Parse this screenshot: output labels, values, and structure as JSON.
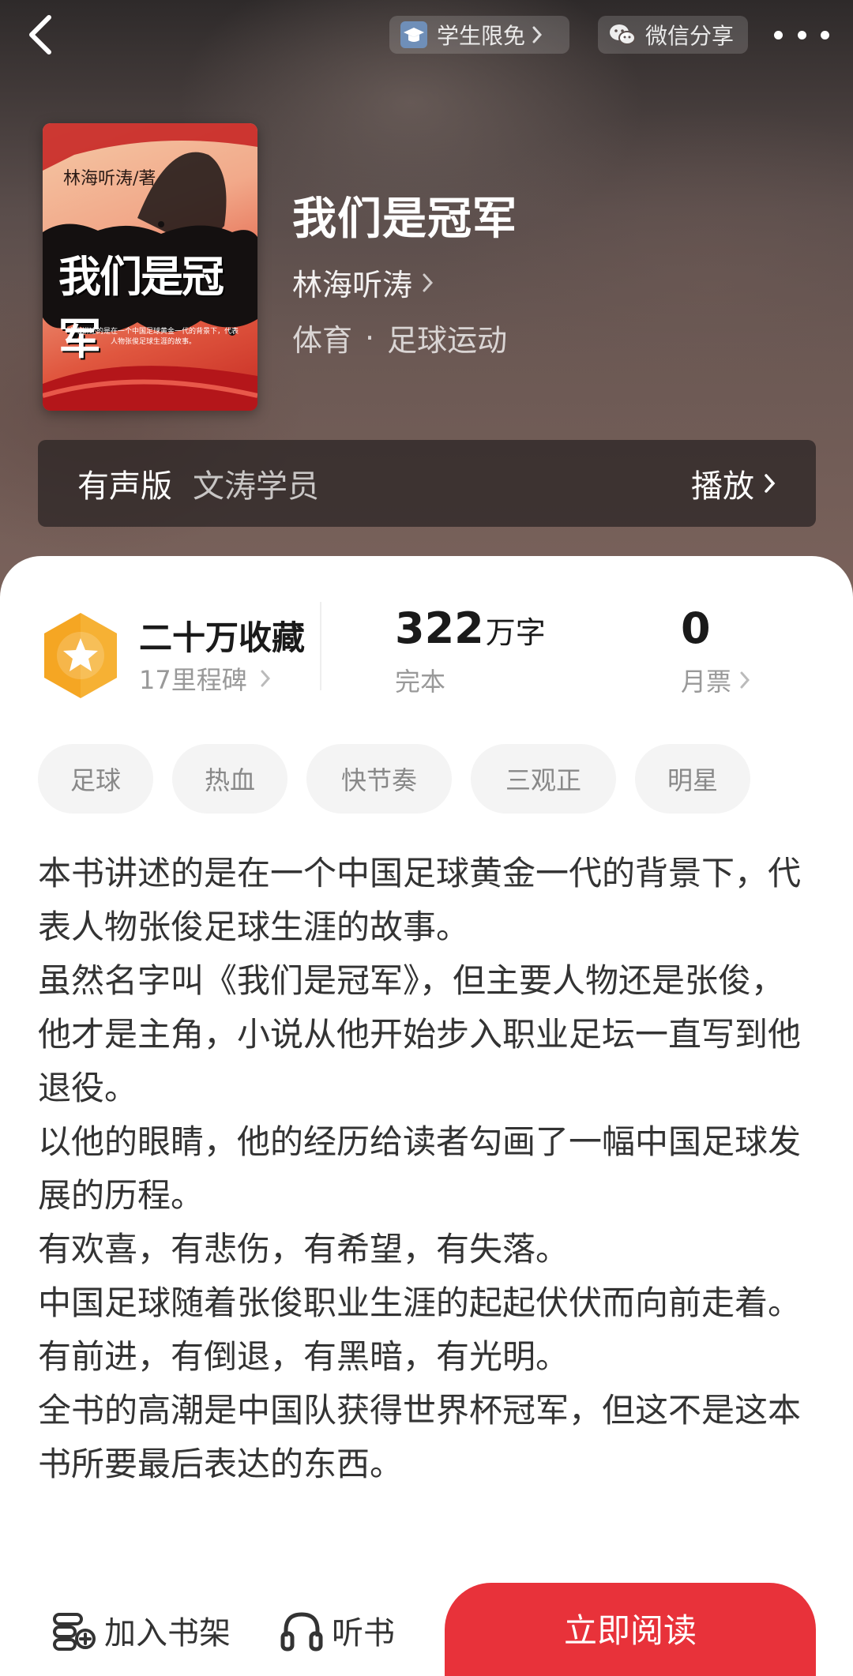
{
  "colors": {
    "accent_red": "#e8323a",
    "badge_orange": "#f5a623",
    "tag_bg": "#f4f4f4"
  },
  "header": {
    "back_icon": "chevron-left-icon",
    "student_free": {
      "label": "学生限免",
      "icon": "graduation-cap-icon"
    },
    "wechat_share": {
      "label": "微信分享",
      "icon": "wechat-icon"
    },
    "more_icon": "more-dots-icon"
  },
  "book": {
    "cover": {
      "author_text": "林海听涛/著",
      "title_text": "我们是冠军",
      "blurb_text": "本书讲述的是在一个中国足球黄金一代的背景下，代表人物张俊足球生涯的故事。"
    },
    "title": "我们是冠军",
    "author": "林海听涛",
    "genre_main": "体育",
    "genre_dot": "·",
    "genre_sub": "足球运动"
  },
  "audio": {
    "label": "有声版",
    "narrator": "文涛学员",
    "play_label": "播放"
  },
  "stats": {
    "favorites": "二十万收藏",
    "milestones": "17里程碑",
    "word_count": "322",
    "word_unit": "万字",
    "status": "完本",
    "monthly_tickets": "0",
    "monthly_tickets_label": "月票"
  },
  "tags": [
    "足球",
    "热血",
    "快节奏",
    "三观正",
    "明星"
  ],
  "description": [
    "本书讲述的是在一个中国足球黄金一代的背景下，代表人物张俊足球生涯的故事。",
    "虽然名字叫《我们是冠军》，但主要人物还是张俊，他才是主角，小说从他开始步入职业足坛一直写到他退役。",
    "以他的眼睛，他的经历给读者勾画了一幅中国足球发展的历程。",
    "有欢喜，有悲伤，有希望，有失落。",
    "中国足球随着张俊职业生涯的起起伏伏而向前走着。",
    "有前进，有倒退，有黑暗，有光明。",
    "全书的高潮是中国队获得世界杯冠军，但这不是这本书所要最后表达的东西。"
  ],
  "bottom": {
    "add_shelf": "加入书架",
    "listen": "听书",
    "read_now": "立即阅读"
  }
}
